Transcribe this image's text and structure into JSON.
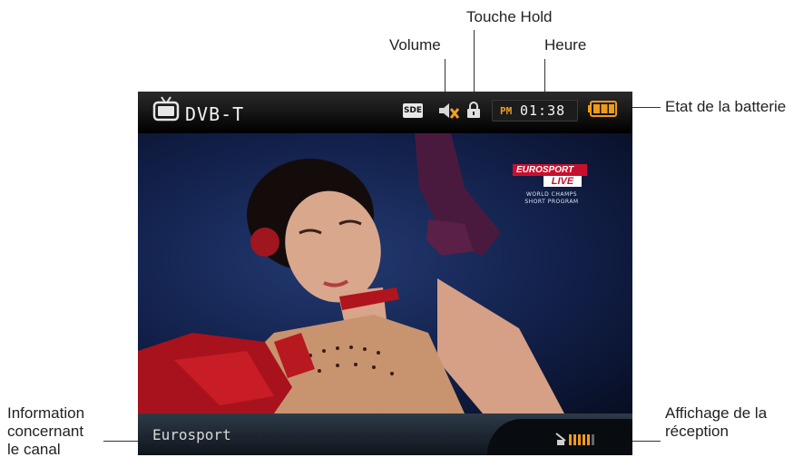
{
  "callouts": {
    "volume": "Volume",
    "hold_key": "Touche Hold",
    "time": "Heure",
    "battery": "Etat de la batterie",
    "channel_info": [
      "Information",
      "concernant",
      "le canal"
    ],
    "reception": [
      "Affichage de la",
      "réception"
    ]
  },
  "device": {
    "mode_label": "DVB-T",
    "quality_badge": "SDE",
    "volume_state": "muted",
    "hold_locked": true,
    "clock": {
      "ampm": "PM",
      "time": "01:38"
    },
    "battery_level": 1.0,
    "channel_name": "Eurosport",
    "signal_level": 0.8
  },
  "broadcast_logo": {
    "line1": "EUROSPORT",
    "line2": "LIVE",
    "sub": "WORLD CHAMPS\nSHORT PROGRAM"
  },
  "icons": [
    "tv-icon",
    "volume-mute-icon",
    "lock-icon",
    "battery-icon",
    "antenna-icon",
    "signal-bars-icon"
  ],
  "colors": {
    "accent_orange": "#f0a020",
    "battery": "#f09a1a",
    "eurosport_red": "#c8102e"
  }
}
